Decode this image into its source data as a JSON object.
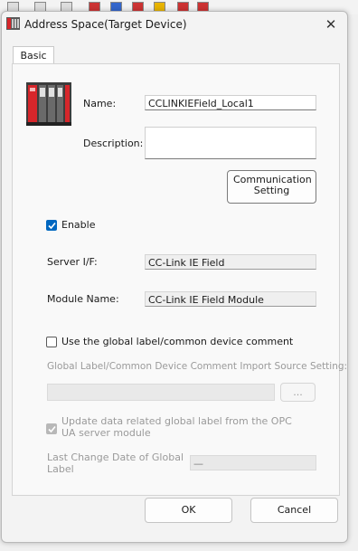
{
  "window": {
    "title": "Address Space(Target Device)",
    "close_glyph": "✕"
  },
  "tabs": [
    {
      "label": "Basic"
    }
  ],
  "form": {
    "name_label": "Name:",
    "name_value": "CCLINKIEField_Local1",
    "description_label": "Description:",
    "description_value": "",
    "comm_button": "Communication Setting",
    "enable_label": "Enable",
    "enable_checked": true,
    "server_if_label": "Server I/F:",
    "server_if_value": "CC-Link IE Field",
    "module_name_label": "Module Name:",
    "module_name_value": "CC-Link IE Field Module",
    "global_label_check": "Use the global label/common device comment",
    "global_label_checked": false,
    "import_source_label": "Global Label/Common Device Comment Import Source Setting:",
    "import_source_value": "",
    "browse_button": "...",
    "update_label": "Update data related global label from the OPC UA server module",
    "update_checked": true,
    "last_change_label": "Last Change Date of Global Label",
    "last_change_value": "—"
  },
  "footer": {
    "ok": "OK",
    "cancel": "Cancel"
  },
  "colors": {
    "accent": "#0067c0",
    "device_red": "#d7262b"
  }
}
